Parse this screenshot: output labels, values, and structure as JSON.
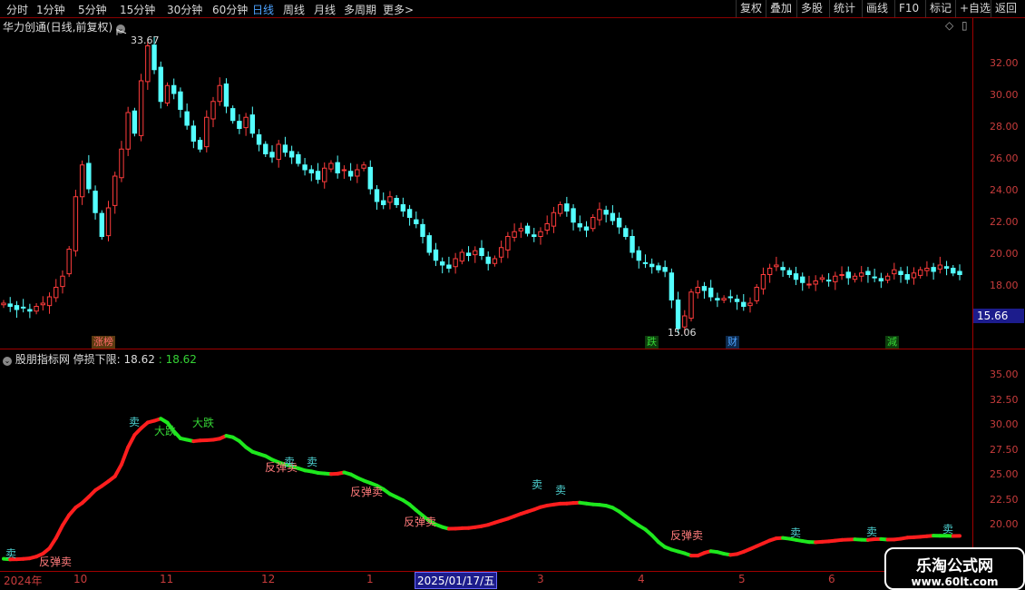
{
  "toolbar": {
    "periods": [
      "分时",
      "1分钟",
      "5分钟",
      "15分钟",
      "30分钟",
      "60分钟",
      "日线",
      "周线",
      "月线",
      "多周期",
      "更多"
    ],
    "active_period": "日线",
    "more_arrow": ">",
    "right_buttons": [
      "复权",
      "叠加",
      "多股",
      "统计",
      "画线",
      "F10",
      "标记",
      "+自选",
      "返回"
    ]
  },
  "main_panel": {
    "title": "华力创通(日线,前复权)",
    "high_label": "33.67",
    "low_label": "15.06",
    "current_price": "15.66",
    "y_ticks": [
      "32.00",
      "30.00",
      "28.00",
      "26.00",
      "24.00",
      "22.00",
      "20.00",
      "18.00"
    ],
    "badges": [
      {
        "text": "涨榜",
        "color": "#ff6a6a"
      },
      {
        "text": "跌",
        "color": "#35d335"
      },
      {
        "text": "财",
        "color": "#4da3ff"
      },
      {
        "text": "減",
        "color": "#35d335"
      }
    ],
    "corner_icons": [
      "◇",
      "▯"
    ]
  },
  "indicator_panel": {
    "title": "股朋指标网",
    "param_label": "停损下限: 18.62",
    "param_value": ": 18.62",
    "y_ticks": [
      "35.00",
      "32.50",
      "30.00",
      "27.50",
      "25.00",
      "22.50",
      "20.00"
    ],
    "signals": [
      "卖",
      "反弹卖",
      "卖",
      "大跌",
      "大跌",
      "反弹卖",
      "卖",
      "卖",
      "反弹卖",
      "反弹卖",
      "卖",
      "卖",
      "反弹卖",
      "卖",
      "卖",
      "卖"
    ]
  },
  "x_axis": {
    "labels": [
      "2024年",
      "10",
      "11",
      "12",
      "1",
      "3",
      "4",
      "5",
      "6"
    ],
    "cursor_date": "2025/01/17/五"
  },
  "watermark": {
    "line1": "乐淘公式网",
    "line2": "www.60lt.com"
  },
  "chart_data": {
    "type": "candlestick",
    "title": "华力创通(日线,前复权)",
    "ylim": [
      15,
      34
    ],
    "annotations": {
      "high": 33.67,
      "low": 15.06
    },
    "closes": [
      16.8,
      16.6,
      16.4,
      16.5,
      16.3,
      16.6,
      16.8,
      17.2,
      17.8,
      18.5,
      20.2,
      23.5,
      25.5,
      24.0,
      22.5,
      21.0,
      22.8,
      24.8,
      26.5,
      28.8,
      27.5,
      30.8,
      33.0,
      31.5,
      29.5,
      30.5,
      30.0,
      29.0,
      28.0,
      27.0,
      26.5,
      28.5,
      29.5,
      30.5,
      29.2,
      28.3,
      27.8,
      28.5,
      27.5,
      26.8,
      26.2,
      26.0,
      26.8,
      26.3,
      26.0,
      25.6,
      25.2,
      25.0,
      24.6,
      25.3,
      25.6,
      25.0,
      25.2,
      24.8,
      25.2,
      25.5,
      24.0,
      23.2,
      23.0,
      23.5,
      23.0,
      22.6,
      22.2,
      21.8,
      21.0,
      20.0,
      19.5,
      19.2,
      19.0,
      19.6,
      20.0,
      19.8,
      20.1,
      19.8,
      19.3,
      19.6,
      20.3,
      21.0,
      21.3,
      21.5,
      21.2,
      21.0,
      21.3,
      21.8,
      22.5,
      23.0,
      22.6,
      21.9,
      21.6,
      21.4,
      22.2,
      22.7,
      22.4,
      22.0,
      21.6,
      21.0,
      20.0,
      19.5,
      19.3,
      19.1,
      18.9,
      18.8,
      17.0,
      15.2,
      16.0,
      17.5,
      17.8,
      17.6,
      17.2,
      17.0,
      17.1,
      17.2,
      16.9,
      16.6,
      16.8,
      17.8,
      18.6,
      19.0,
      19.2,
      18.9,
      18.6,
      18.3,
      18.1,
      18.0,
      18.2,
      18.4,
      18.2,
      18.5,
      18.6,
      18.4,
      18.5,
      18.7,
      18.6,
      18.4,
      18.2,
      18.5,
      18.9,
      18.6,
      18.3,
      18.7,
      18.9,
      19.0,
      18.8,
      19.2,
      19.0,
      18.7,
      18.6
    ]
  }
}
